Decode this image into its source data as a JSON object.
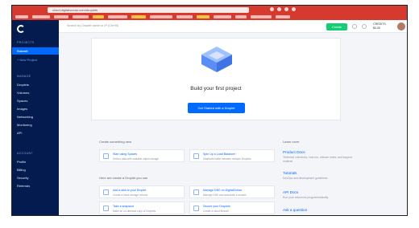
{
  "browser": {
    "url": "cloud.digitalocean.com/droplets"
  },
  "sidebar": {
    "projects_label": "PROJECTS",
    "active_project": "Submit",
    "new_project": "+ New Project",
    "manage_label": "MANAGE",
    "manage_items": [
      "Droplets",
      "Volumes",
      "Spaces",
      "Images",
      "Networking",
      "Monitoring",
      "API"
    ],
    "account_label": "ACCOUNT",
    "account_items": [
      "Profile",
      "Billing",
      "Security",
      "Referrals"
    ]
  },
  "topbar": {
    "search_placeholder": "Search by Droplet name or IP (Ctrl+B)",
    "create_label": "Create",
    "credits_top": "CREDITS",
    "credits_bottom": "$0.00"
  },
  "hero": {
    "title": "Build your first project",
    "button": "Get Started with a Droplet"
  },
  "sections": {
    "create_label": "Create something new",
    "try_label": "Here are create a Droplet you can",
    "learn_label": "Learn more"
  },
  "cards": [
    {
      "title": "Start using Spaces",
      "desc": "Deliver data with scalable object storage"
    },
    {
      "title": "Spin Up a Load Balancer",
      "desc": "Distribute traffic between multiple Droplets"
    },
    {
      "title": "Add a disk to your Droplet",
      "desc": "Create a block storage volume"
    },
    {
      "title": "Manage DNS on DigitalOcean",
      "desc": "Manage DNS and associate a domain"
    },
    {
      "title": "Take a snapshot",
      "desc": "Make an on-demand copy of Droplets"
    },
    {
      "title": "Secure your Droplets",
      "desc": "Create a cloud firewall"
    }
  ],
  "learn": [
    {
      "title": "Product Docs",
      "desc": "Technical overviews, how-tos, release notes, and support material"
    },
    {
      "title": "Tutorials",
      "desc": "DevOps and development guidelines"
    },
    {
      "title": "API Docs",
      "desc": "Run your resources programmatically"
    },
    {
      "title": "Ask a question",
      "desc": ""
    }
  ]
}
